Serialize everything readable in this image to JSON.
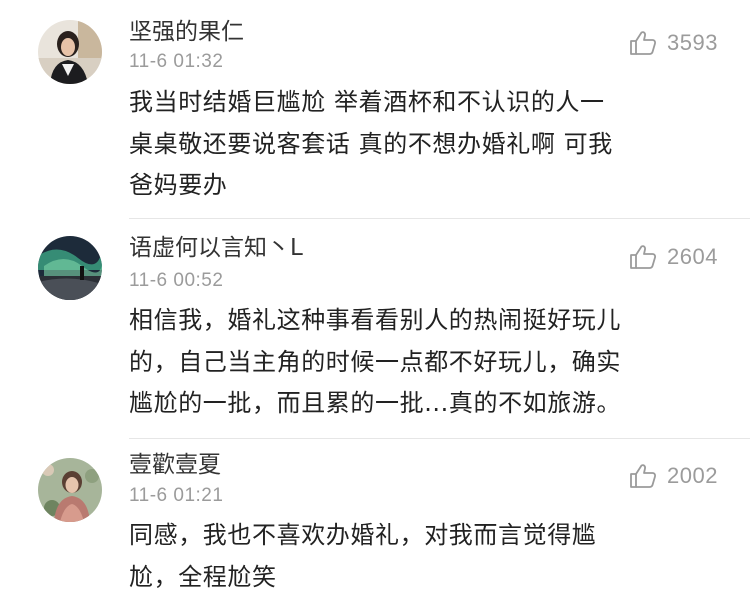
{
  "comments": [
    {
      "username": "坚强的果仁",
      "timestamp": "11-6 01:32",
      "likes": "3593",
      "avatar_icon": "avatar-woman-portrait",
      "lines": [
        "我当时结婚巨尴尬  举着酒杯和不认识的人一",
        "桌桌敬还要说客套话  真的不想办婚礼啊  可我",
        "爸妈要办"
      ]
    },
    {
      "username": "语虚何以言知丶L",
      "timestamp": "11-6 00:52",
      "likes": "2604",
      "avatar_icon": "avatar-aurora-landscape",
      "lines": [
        "相信我，婚礼这种事看看别人的热闹挺好玩儿",
        "的，自己当主角的时候一点都不好玩儿，确实",
        "尴尬的一批，而且累的一批...真的不如旅游。"
      ]
    },
    {
      "username": "壹歡壹夏",
      "timestamp": "11-6 01:21",
      "likes": "2002",
      "avatar_icon": "avatar-girl-flowers",
      "lines": [
        "同感，我也不喜欢办婚礼，对我而言觉得尴",
        "尬，全程尬笑"
      ]
    }
  ],
  "colors": {
    "username": "#333333",
    "meta": "#9b9b9b",
    "body_text": "#222222",
    "divider": "#e6e6e6"
  },
  "icons": {
    "like": "thumbs-up-icon"
  }
}
